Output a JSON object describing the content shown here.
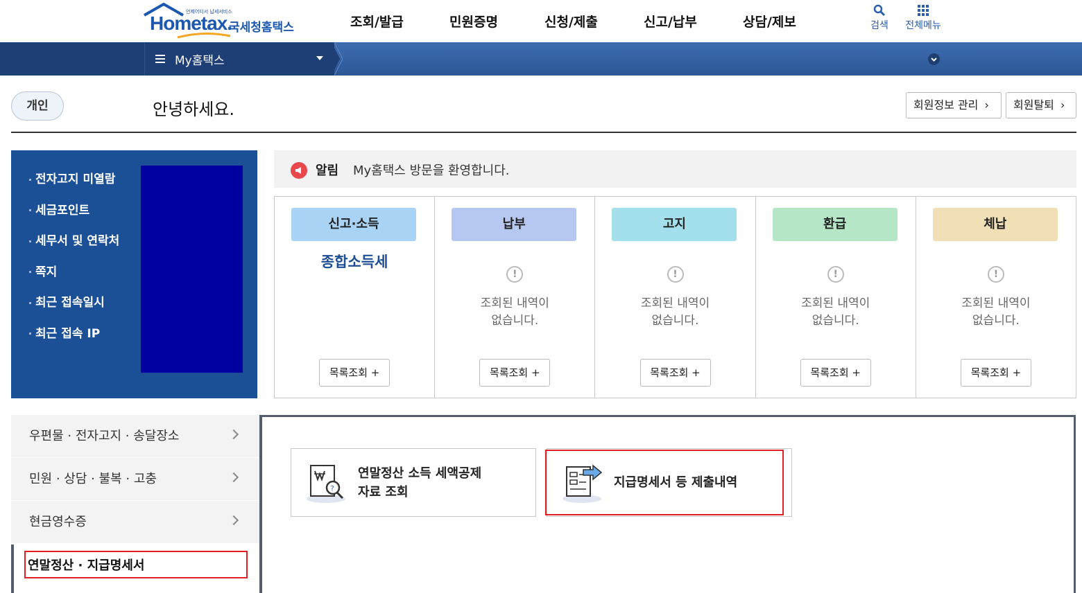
{
  "header": {
    "logo_tag": "언제어디서 납세서비스",
    "logo_word": "Hometax.",
    "logo_kr": "국세청홈택스",
    "menu": [
      "조회/발급",
      "민원증명",
      "신청/제출",
      "신고/납부",
      "상담/제보"
    ],
    "search_label": "검색",
    "allmenu_label": "전체메뉴"
  },
  "nav": {
    "title": "My홈택스"
  },
  "greeting": {
    "user_type": "개인",
    "hello": "안녕하세요.",
    "member_info_btn": "회원정보 관리",
    "withdraw_btn": "회원탈퇴"
  },
  "info": {
    "items": [
      "전자고지 미열람",
      "세금포인트",
      "세무서 및 연락처",
      "쪽지",
      "최근 접속일시",
      "최근 접속 IP"
    ]
  },
  "notice": {
    "label": "알림",
    "message": "My홈택스 방문을 환영합니다."
  },
  "cards": [
    {
      "title": "신고·소득",
      "color": "#a9d3f4",
      "tax": "종합소득세",
      "empty": "",
      "list_btn": "목록조회 +"
    },
    {
      "title": "납부",
      "color": "#b6c7f2",
      "tax": "",
      "empty": "조회된 내역이 없습니다.",
      "list_btn": "목록조회 +"
    },
    {
      "title": "고지",
      "color": "#a3e0ec",
      "tax": "",
      "empty": "조회된 내역이 없습니다.",
      "list_btn": "목록조회 +"
    },
    {
      "title": "환급",
      "color": "#b5e7c6",
      "tax": "",
      "empty": "조회된 내역이 없습니다.",
      "list_btn": "목록조회 +"
    },
    {
      "title": "체납",
      "color": "#f1e0b6",
      "tax": "",
      "empty": "조회된 내역이 없습니다.",
      "list_btn": "목록조회 +"
    }
  ],
  "empty_line1": "조회된 내역이",
  "empty_line2": "없습니다.",
  "side_menu": {
    "items": [
      "우편물 · 전자고지 · 송달장소",
      "민원 · 상담 · 불복 · 고충",
      "현금영수증"
    ],
    "active": "연말정산 · 지급명세서"
  },
  "tiles": {
    "t1_line1": "연말정산 소득 세액공제",
    "t1_line2": "자료 조회",
    "t2": "지급명세서 등 제출내역"
  },
  "colors": {
    "brand": "#1c57b0",
    "nav_dark": "#1d3f76",
    "highlight": "#e31e24"
  }
}
